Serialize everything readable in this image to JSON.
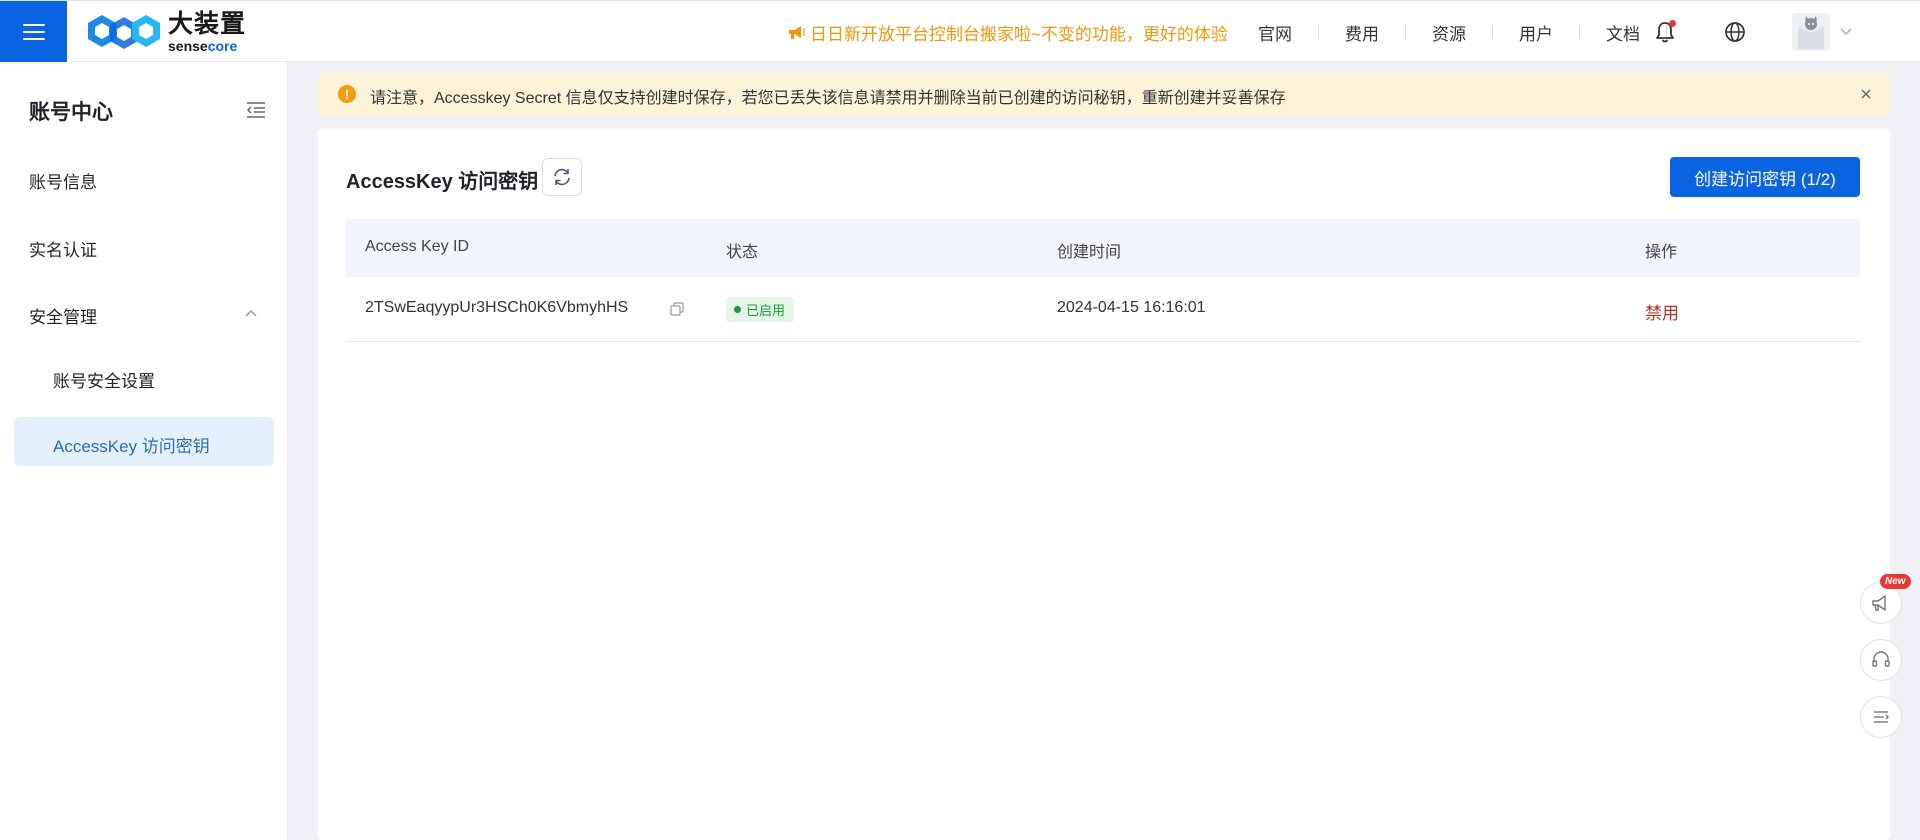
{
  "header": {
    "brand_cn": "大装置",
    "brand_en_prefix": "sense",
    "brand_en_suffix": "core",
    "announcement": "日日新开放平台控制台搬家啦~不变的功能，更好的体验",
    "nav": [
      "官网",
      "费用",
      "资源",
      "用户",
      "文档"
    ]
  },
  "sidebar": {
    "title": "账号中心",
    "items": [
      "账号信息",
      "实名认证",
      "安全管理"
    ],
    "sub_items": [
      "账号安全设置",
      "AccessKey 访问密钥"
    ]
  },
  "alert": {
    "message": "请注意，Accesskey Secret 信息仅支持创建时保存，若您已丢失该信息请禁用并删除当前已创建的访问秘钥，重新创建并妥善保存"
  },
  "main": {
    "title": "AccessKey 访问密钥",
    "create_button": "创建访问密钥 (1/2)",
    "table": {
      "columns": [
        "Access Key ID",
        "状态",
        "创建时间",
        "操作"
      ],
      "rows": [
        {
          "key_id": "2TSwEaqyypUr3HSCh0K6VbmyhHS",
          "status": "已启用",
          "created": "2024-04-15 16:16:01",
          "action": "禁用"
        }
      ]
    }
  },
  "float": {
    "new_badge": "New"
  },
  "colors": {
    "primary": "#0a63e0",
    "announcement": "#f0950c",
    "status_enabled": "#1a9a3b",
    "danger": "#b5322a",
    "active_nav_bg": "#e4f1fc"
  },
  "icons": {
    "menu": "menu-icon",
    "announcement": "megaphone-icon",
    "bell": "bell-icon",
    "globe": "globe-icon",
    "collapse": "collapse-menu-icon",
    "refresh": "refresh-icon",
    "copy": "copy-icon",
    "warning": "warning-icon",
    "close": "close-icon"
  }
}
